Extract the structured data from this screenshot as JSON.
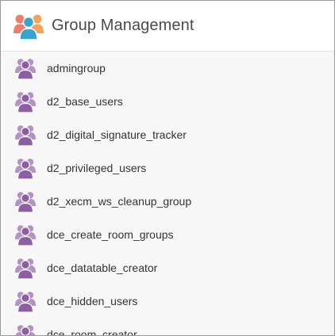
{
  "header": {
    "title": "Group Management",
    "icon": "group-management-icon"
  },
  "group_icon": "user-group-icon",
  "colors": {
    "group_icon": "#8e5ea2",
    "header_left_person": "#f07d6b",
    "header_right_person": "#f5a35c",
    "header_center_person": "#3aa3d5"
  },
  "groups": [
    {
      "label": "admingroup"
    },
    {
      "label": "d2_base_users"
    },
    {
      "label": "d2_digital_signature_tracker"
    },
    {
      "label": "d2_privileged_users"
    },
    {
      "label": "d2_xecm_ws_cleanup_group"
    },
    {
      "label": "dce_create_room_groups"
    },
    {
      "label": "dce_datatable_creator"
    },
    {
      "label": "dce_hidden_users"
    },
    {
      "label": "dce_room_creator"
    }
  ]
}
